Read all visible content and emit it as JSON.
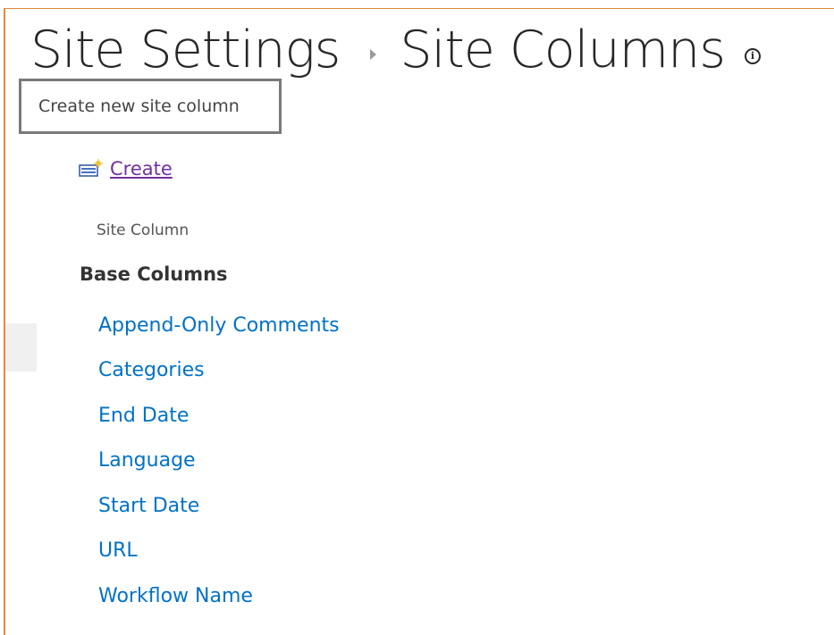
{
  "header": {
    "breadcrumb_parent": "Site Settings",
    "breadcrumb_current": "Site Columns",
    "info_icon": "info-circle-icon"
  },
  "tooltip": {
    "text": "Create new site column"
  },
  "toolbar": {
    "create_label": "Create",
    "create_icon": "new-column-icon"
  },
  "table": {
    "column_header": "Site Column"
  },
  "groups": [
    {
      "name": "Base Columns",
      "columns": [
        "Append-Only Comments",
        "Categories",
        "End Date",
        "Language",
        "Start Date",
        "URL",
        "Workflow Name"
      ]
    }
  ],
  "colors": {
    "accent_border": "#e8873a",
    "link": "#0072c6",
    "visited_link": "#7030a0",
    "title_text": "#262626"
  }
}
